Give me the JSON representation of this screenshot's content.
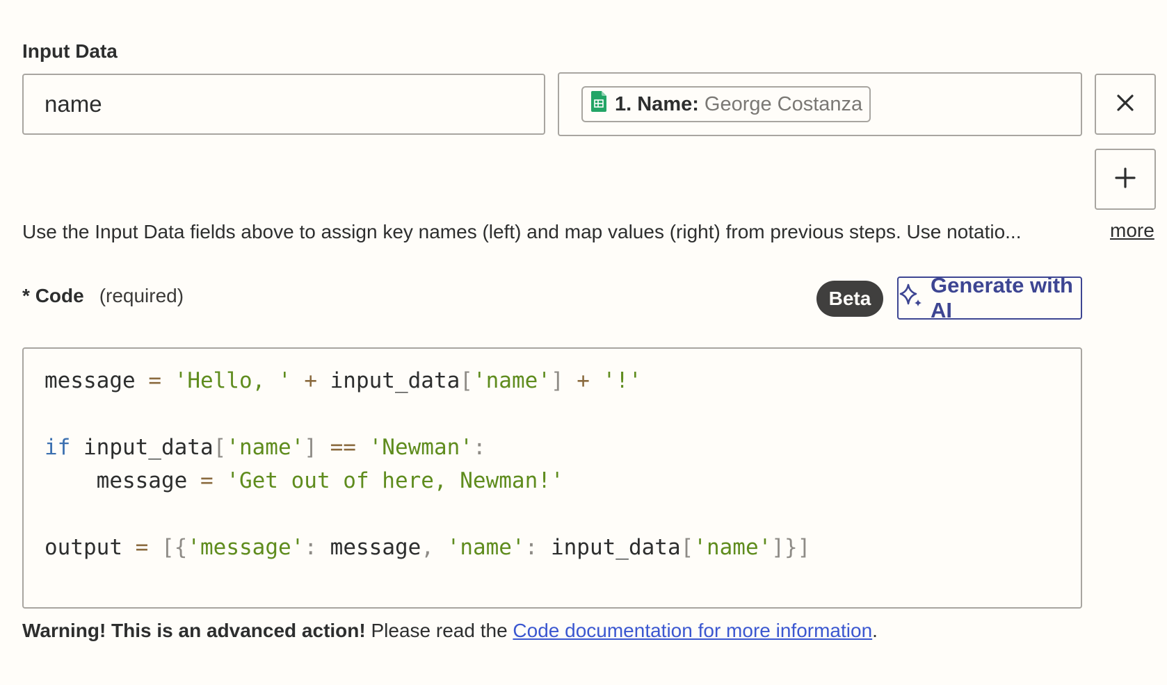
{
  "input_data": {
    "label": "Input Data",
    "key_value": "name",
    "mapped_field": {
      "label": "1. Name:",
      "value": "George Costanza",
      "icon": "google-sheets-icon"
    },
    "remove_icon": "close-icon",
    "add_icon": "plus-icon",
    "help_text": "Use the Input Data fields above to assign key names (left) and map values (right) from previous steps. Use notatio...",
    "more_label": "more"
  },
  "code": {
    "asterisk": "*",
    "label": "Code",
    "required_text": "(required)",
    "beta_label": "Beta",
    "generate_label": "Generate with AI",
    "generate_icon": "sparkle-icon",
    "lines": [
      "message = 'Hello, ' + input_data['name'] + '!'",
      "",
      "if input_data['name'] == 'Newman':",
      "    message = 'Get out of here, Newman!'",
      "",
      "output = [{'message': message, 'name': input_data['name']}]"
    ]
  },
  "warning": {
    "strong": "Warning! This is an advanced action!",
    "text": " Please read the ",
    "link": "Code documentation for more information",
    "end": "."
  },
  "colors": {
    "accent": "#3d4592",
    "border": "#a8a5a0",
    "link": "#3b57d0",
    "code_string": "#5f8c1e",
    "code_keyword": "#3c70b0",
    "badge_bg": "#403f3e"
  }
}
